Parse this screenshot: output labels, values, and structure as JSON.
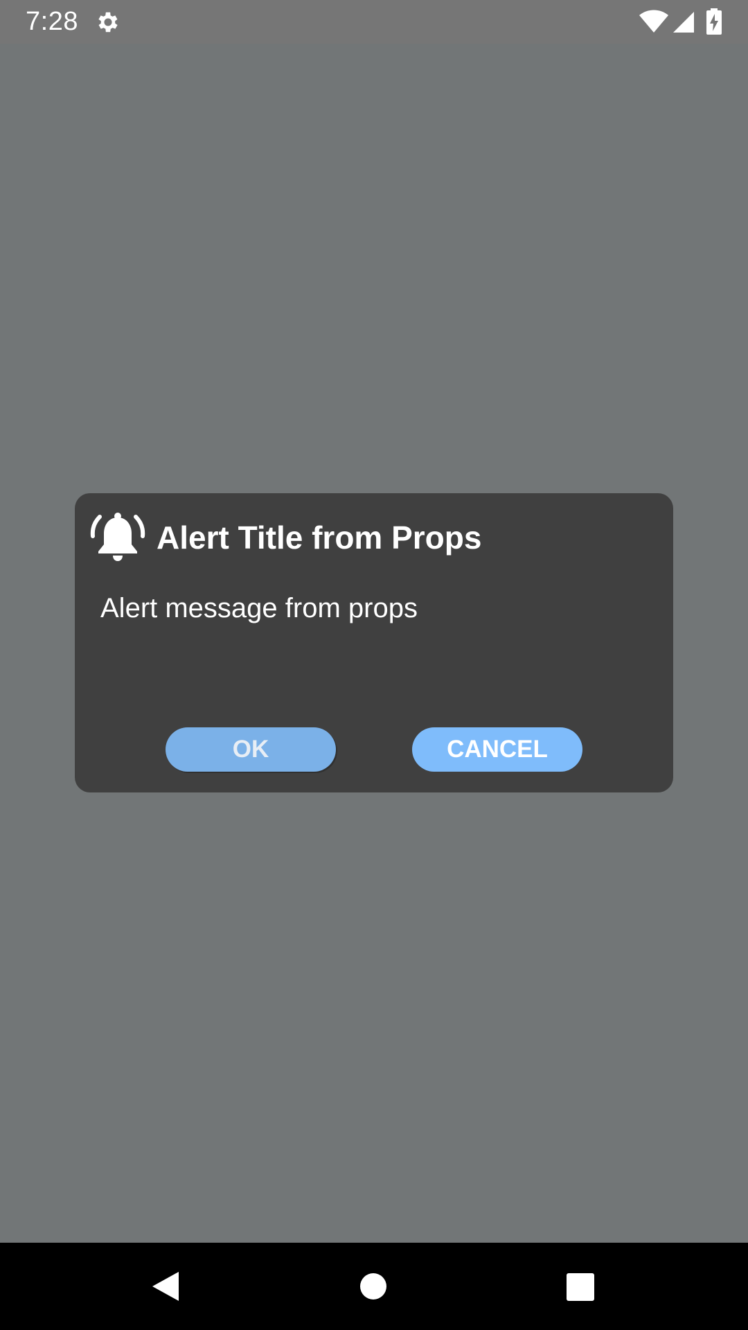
{
  "status_bar": {
    "time": "7:28",
    "icons": [
      "gear-icon",
      "wifi-icon",
      "cell-signal-icon",
      "battery-charging-icon"
    ]
  },
  "dialog": {
    "icon": "bell-ringing-icon",
    "title": "Alert Title from Props",
    "message": "Alert message from props",
    "buttons": {
      "ok_label": "OK",
      "cancel_label": "CANCEL"
    }
  },
  "nav_bar": {
    "icons": [
      "back-icon",
      "home-icon",
      "recents-icon"
    ]
  },
  "colors": {
    "scrim": "#727677",
    "dialog_background": "#404040",
    "ok_button": "#7bb1e8",
    "cancel_button": "#7fbcfb",
    "text": "#ffffff"
  }
}
